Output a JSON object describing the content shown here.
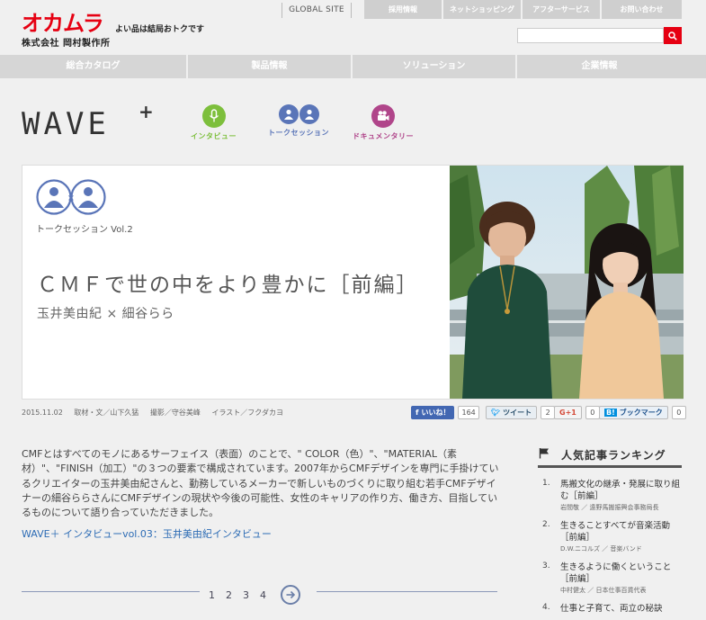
{
  "brand": {
    "logo_text": "オカムラ",
    "company": "株式会社 岡村製作所",
    "tagline": "よい品は結局おトクです",
    "red": "#e60012"
  },
  "utility": {
    "global_site": "GLOBAL SITE",
    "items": [
      "採用情報",
      "ネットショッピング",
      "アフターサービス",
      "お問い合わせ"
    ],
    "search_placeholder": ""
  },
  "main_nav": {
    "items": [
      "総合カタログ",
      "製品情報",
      "ソリューション",
      "企業情報"
    ]
  },
  "wave": {
    "logo": "WAVE",
    "plus": "+",
    "categories": [
      {
        "label": "インタビュー",
        "icon": "microphone-icon",
        "color": "#7dbf3c"
      },
      {
        "label": "トークセッション",
        "icon": "talk-session-icon",
        "color": "#5a75b8"
      },
      {
        "label": "ドキュメンタリー",
        "icon": "video-camera-icon",
        "color": "#b0458a"
      }
    ]
  },
  "article": {
    "series": "トークセッション Vol.2",
    "title": "ＣＭＦで世の中をより豊かに［前編］",
    "authors": "玉井美由紀 × 細谷らら",
    "meta": {
      "date": "2015.11.02",
      "credit1": "取材・文／山下久猛",
      "credit2": "撮影／守谷美峰",
      "credit3": "イラスト／フクダカヨ"
    },
    "social": {
      "fb_label": "いいね！",
      "fb_count": "164",
      "tw_label": "ツイート",
      "tw_count": "2",
      "gp_label": "G+1",
      "gp_count": "0",
      "hb_label": "ブックマーク",
      "hb_count": "0"
    },
    "intro": "CMFとはすべてのモノにあるサーフェイス（表面）のことで、\" COLOR（色）\"、\"MATERIAL（素材）\"、\"FINISH（加工）\"の３つの要素で構成されています。2007年からCMFデザインを専門に手掛けているクリエイターの玉井美由紀さんと、勤務しているメーカーで新しいものづくりに取り組む若手CMFデザイナーの細谷ららさんにCMFデザインの現状や今後の可能性、女性のキャリアの作り方、働き方、目指しているものについて語り合っていただきました。",
    "related_link": "WAVE＋ インタビューvol.03：玉井美由紀インタビュー"
  },
  "pagination": {
    "pages": [
      "1",
      "2",
      "3",
      "4"
    ],
    "accent": "#6b7fa8"
  },
  "ranking": {
    "title": "人気記事ランキング",
    "items": [
      {
        "num": "1.",
        "title": "馬搬文化の継承・発展に取り組む［前編］",
        "sub": "岩間敬 ／ 遠野馬搬振興会事務局長"
      },
      {
        "num": "2.",
        "title": "生きることすべてが音楽活動［前編］",
        "sub": "D.W.ニコルズ ／ 音楽バンド"
      },
      {
        "num": "3.",
        "title": "生きるように働くということ［前編］",
        "sub": "中村健太 ／ 日本仕事百貨代表"
      },
      {
        "num": "4.",
        "title": "仕事と子育て、両立の秘訣",
        "sub": ""
      }
    ]
  }
}
